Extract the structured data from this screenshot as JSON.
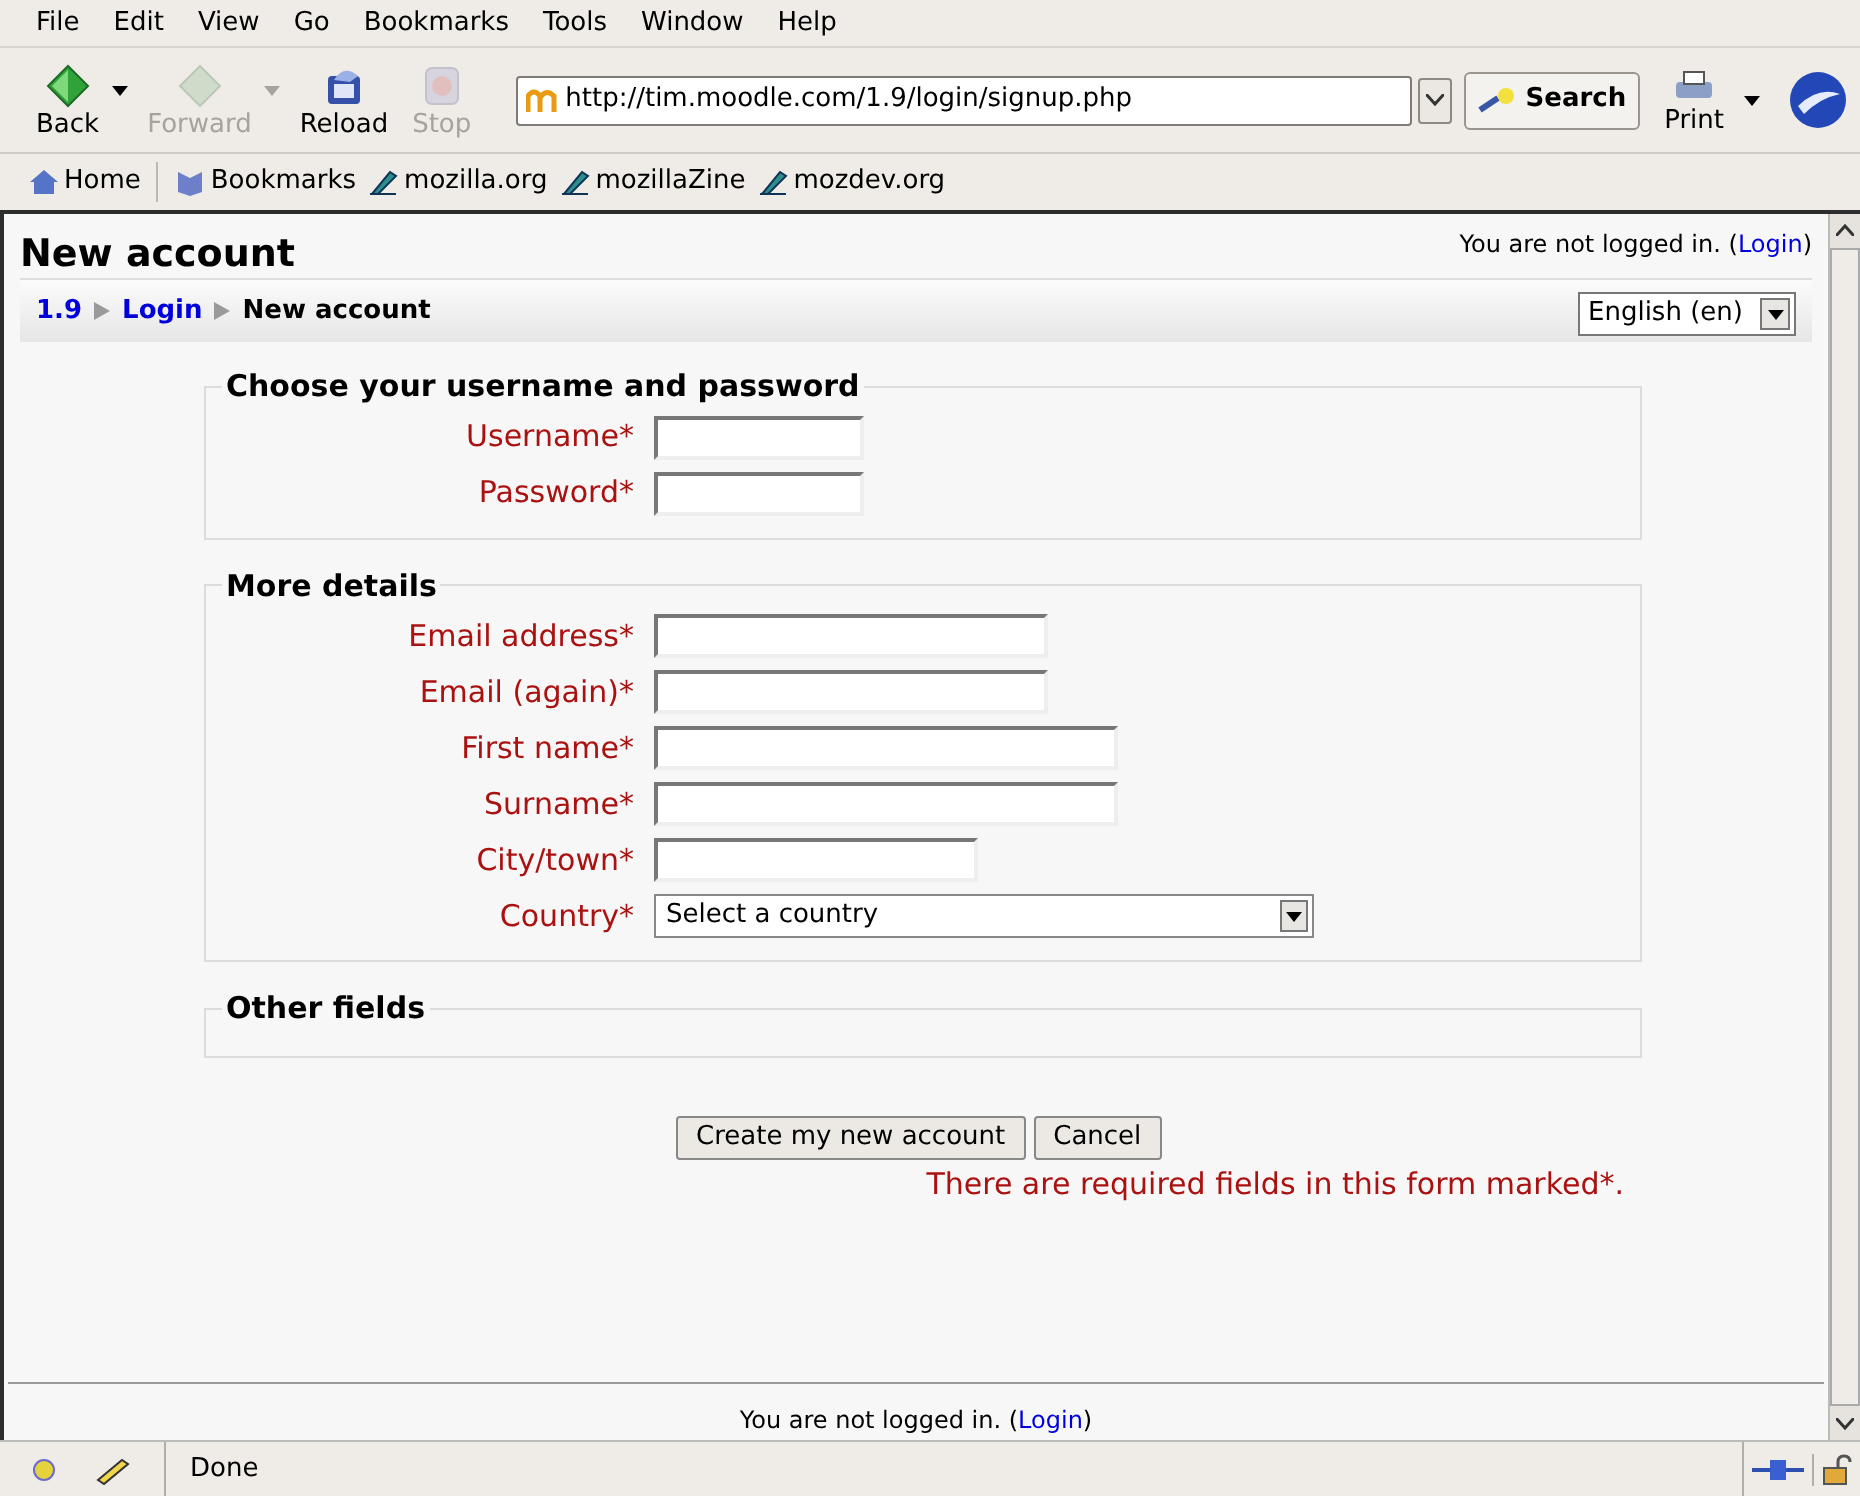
{
  "menu": [
    "File",
    "Edit",
    "View",
    "Go",
    "Bookmarks",
    "Tools",
    "Window",
    "Help"
  ],
  "nav_buttons": [
    {
      "label": "Back",
      "disabled": false,
      "dropdown": true
    },
    {
      "label": "Forward",
      "disabled": true,
      "dropdown": true
    },
    {
      "label": "Reload",
      "disabled": false,
      "dropdown": false
    },
    {
      "label": "Stop",
      "disabled": true,
      "dropdown": false
    }
  ],
  "address": "http://tim.moodle.com/1.9/login/signup.php",
  "search_button": "Search",
  "print_button": "Print",
  "bookmarks": [
    {
      "label": "Home",
      "kind": "home"
    },
    {
      "label": "Bookmarks",
      "kind": "folder"
    },
    {
      "label": "mozilla.org",
      "kind": "link"
    },
    {
      "label": "mozillaZine",
      "kind": "link"
    },
    {
      "label": "mozdev.org",
      "kind": "link"
    }
  ],
  "page": {
    "title": "New account",
    "login_notice": {
      "before": "You are not logged in. (",
      "link": "Login",
      "after": ")"
    },
    "breadcrumb": [
      {
        "label": "1.9",
        "link": true
      },
      {
        "label": "Login",
        "link": true
      },
      {
        "label": "New account",
        "link": false
      }
    ],
    "language": "English (en)",
    "fieldsets": [
      {
        "legend": "Choose your username and password",
        "fields": [
          {
            "label": "Username*",
            "kind": "text"
          },
          {
            "label": "Password*",
            "kind": "text"
          }
        ]
      },
      {
        "legend": "More details",
        "fields": [
          {
            "label": "Email address*",
            "kind": "text"
          },
          {
            "label": "Email (again)*",
            "kind": "text"
          },
          {
            "label": "First name*",
            "kind": "text"
          },
          {
            "label": "Surname*",
            "kind": "text"
          },
          {
            "label": "City/town*",
            "kind": "text"
          },
          {
            "label": "Country*",
            "kind": "select",
            "value": "Select a country"
          }
        ]
      },
      {
        "legend": "Other fields"
      }
    ],
    "buttons": [
      "Create my new account",
      "Cancel"
    ],
    "required_note": "There are required fields in this form marked*.",
    "footer_notice": {
      "before": "You are not logged in. (",
      "link": "Login",
      "after": ")"
    }
  },
  "status": "Done"
}
